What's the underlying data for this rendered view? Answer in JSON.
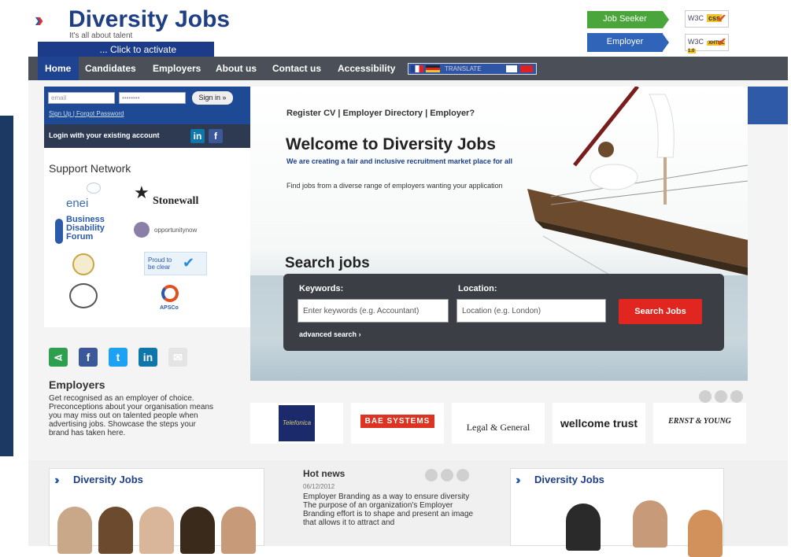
{
  "header": {
    "logo_title": "Diversity Jobs",
    "logo_tagline": "It's all about talent",
    "activate_label": "... Click to activate",
    "job_seeker_label": "Job Seeker",
    "employer_label": "Employer",
    "badge_top": "W3C",
    "badge_top_tag": "css",
    "badge_bottom": "W3C",
    "badge_bottom_tag": "XHTML 1.0"
  },
  "nav": {
    "items": [
      "Home",
      "Candidates",
      "Employers",
      "About us",
      "Contact us",
      "Accessibility"
    ],
    "translate_label": "TRANSLATE"
  },
  "login": {
    "email_placeholder": "email",
    "password_placeholder": "••••••••",
    "sign_in_label": "Sign in »",
    "sign_up_label": "Sign Up",
    "forgot_label": "Forgot Password",
    "existing_account_label": "Login with your existing account",
    "linkedin_icon": "in",
    "facebook_icon": "f"
  },
  "support": {
    "title": "Support Network",
    "partners": [
      "enei",
      "Stonewall",
      "Business Disability Forum",
      "opportunitynow",
      "Proud to be clear",
      "APSCo"
    ]
  },
  "employers": {
    "title": "Employers",
    "text": "Get recognised as an employer of choice. Preconceptions about your organisation means you may miss out on talented people when advertising jobs. Showcase the steps your brand has taken here."
  },
  "hero": {
    "register_links": "Register CV | Employer Directory | Employer?",
    "welcome": "Welcome to Diversity Jobs",
    "subtitle": "We are creating a fair and inclusive recruitment market place for all",
    "description": "Find jobs from a diverse range of employers wanting your application"
  },
  "search": {
    "title": "Search jobs",
    "keywords_label": "Keywords:",
    "location_label": "Location:",
    "keywords_placeholder": "Enter keywords (e.g. Accountant)",
    "location_placeholder": "Location (e.g. London)",
    "button_label": "Search Jobs",
    "advanced_label": "advanced search"
  },
  "employer_logos": [
    "Telefonica",
    "BAE SYSTEMS",
    "Legal & General",
    "wellcome trust",
    "ERNST & YOUNG"
  ],
  "bottom": {
    "left_card_title": "Diversity Jobs",
    "hot_news_title": "Hot news",
    "hot_news_date": "06/12/2012",
    "hot_news_text": "Employer Branding as a way to ensure diversity The purpose of an organization's Employer Branding effort is to shape and present an image that allows it to attract and",
    "right_card_title": "Diversity Jobs"
  },
  "colors": {
    "brand_blue": "#1e3f86",
    "nav_bg": "#4b4f58",
    "search_red": "#e0261f",
    "seeker_green": "#4aa53a"
  }
}
